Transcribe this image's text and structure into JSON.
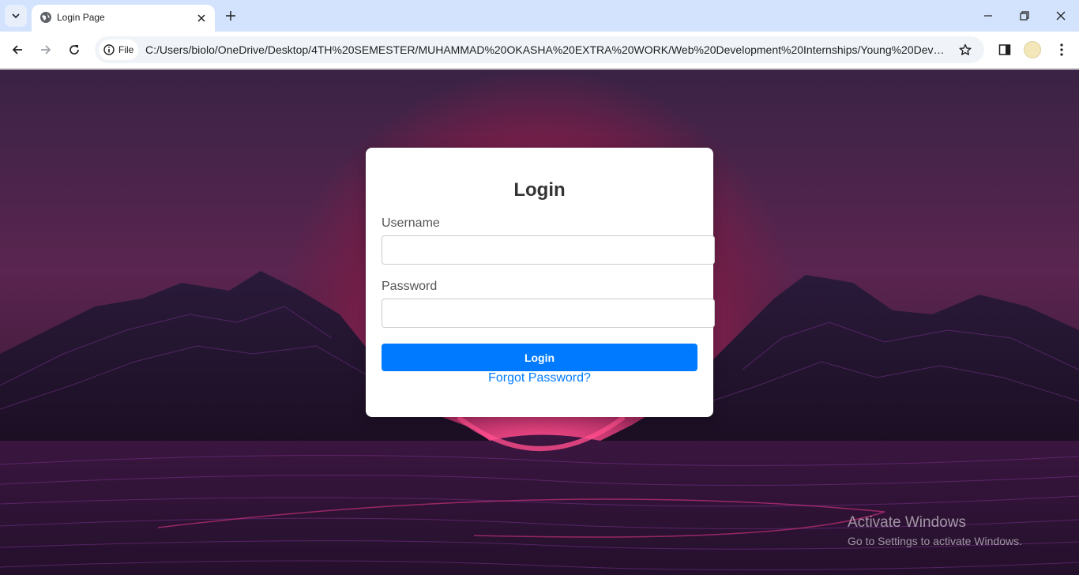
{
  "browser": {
    "tab_title": "Login Page",
    "file_chip_label": "File",
    "url": "C:/Users/biolo/OneDrive/Desktop/4TH%20SEMESTER/MUHAMMAD%20OKASHA%20EXTRA%20WORK/Web%20Development%20Internships/Young%20Dev%20Int..."
  },
  "login": {
    "title": "Login",
    "username_label": "Username",
    "username_value": "",
    "password_label": "Password",
    "password_value": "",
    "submit_label": "Login",
    "forgot_link": "Forgot Password?"
  },
  "watermark": {
    "line1": "Activate Windows",
    "line2": "Go to Settings to activate Windows."
  },
  "colors": {
    "accent": "#007bff",
    "tabbar": "#d3e3fd"
  },
  "icons": [
    "tab-search-icon",
    "globe-icon",
    "close-icon",
    "plus-icon",
    "minimize-icon",
    "restore-icon",
    "window-close-icon",
    "back-icon",
    "forward-icon",
    "reload-icon",
    "info-icon",
    "star-icon",
    "side-panel-icon",
    "profile-avatar",
    "kebab-menu-icon"
  ]
}
